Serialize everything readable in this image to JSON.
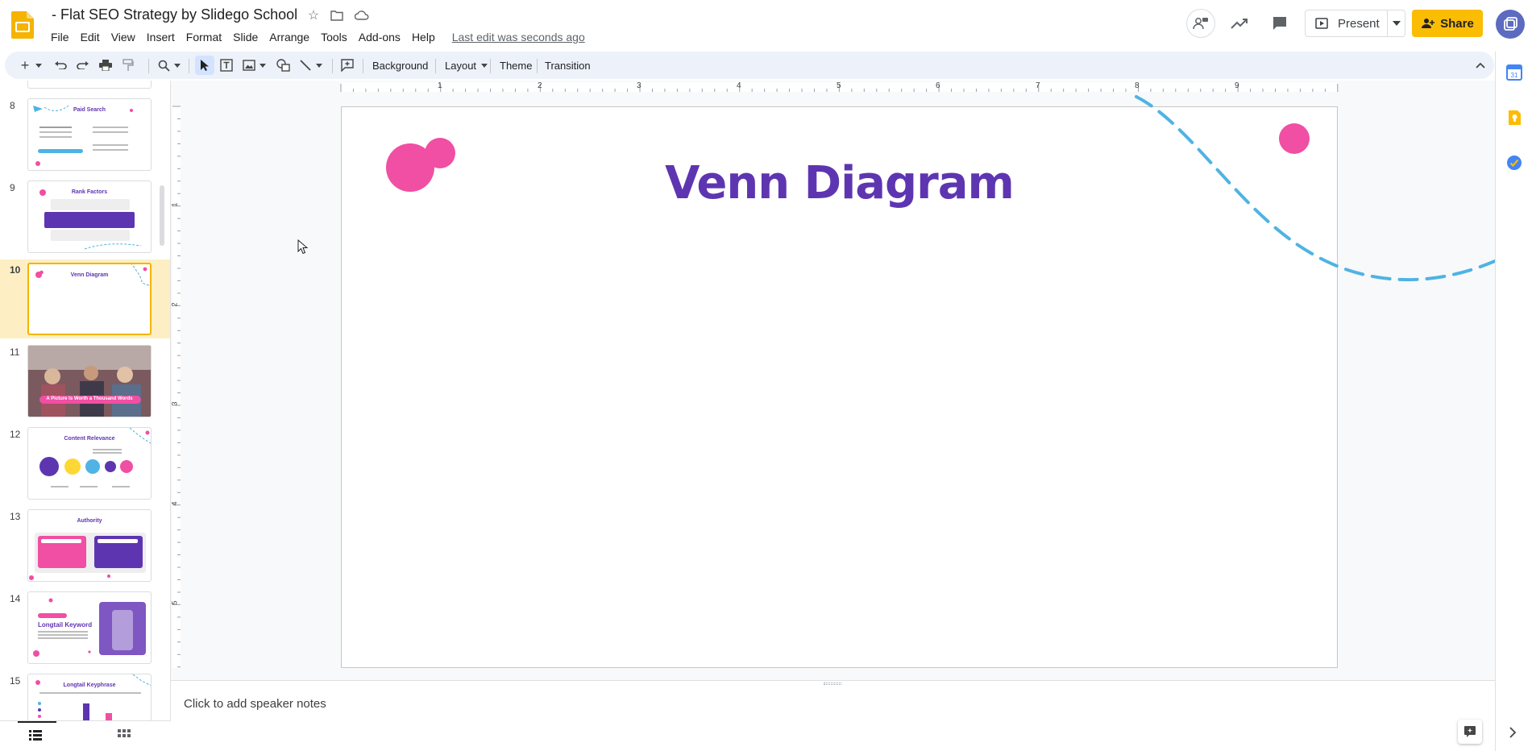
{
  "app": {
    "doc_title": "- Flat SEO Strategy by Slidego School",
    "last_edit": "Last edit was seconds ago",
    "present_label": "Present",
    "share_label": "Share"
  },
  "menu": [
    "File",
    "Edit",
    "View",
    "Insert",
    "Format",
    "Slide",
    "Arrange",
    "Tools",
    "Add-ons",
    "Help"
  ],
  "toolbar": {
    "background_label": "Background",
    "layout_label": "Layout",
    "theme_label": "Theme",
    "transition_label": "Transition"
  },
  "ruler": {
    "h_ticks": [
      "1",
      "2",
      "3",
      "4",
      "5",
      "6",
      "7",
      "8",
      "9"
    ],
    "v_ticks": [
      "1",
      "2",
      "3",
      "4",
      "5"
    ]
  },
  "filmstrip": {
    "selected": "10",
    "slides": [
      {
        "num": "8",
        "title": "Paid Search"
      },
      {
        "num": "9",
        "title": "Rank Factors"
      },
      {
        "num": "10",
        "title": "Venn Diagram"
      },
      {
        "num": "11",
        "title": "A Picture Is Worth a Thousand Words"
      },
      {
        "num": "12",
        "title": "Content Relevance"
      },
      {
        "num": "13",
        "title": "Authority"
      },
      {
        "num": "14",
        "title": "Longtail Keyword"
      },
      {
        "num": "15",
        "title": "Longtail Keyphrase"
      }
    ]
  },
  "slide": {
    "title": "Venn Diagram"
  },
  "notes": {
    "placeholder": "Click to add speaker notes"
  },
  "colors": {
    "accent_purple": "#5e35b1",
    "accent_pink": "#f04fa3",
    "accent_blue": "#4fb3e3",
    "share_yellow": "#fbbc04"
  }
}
